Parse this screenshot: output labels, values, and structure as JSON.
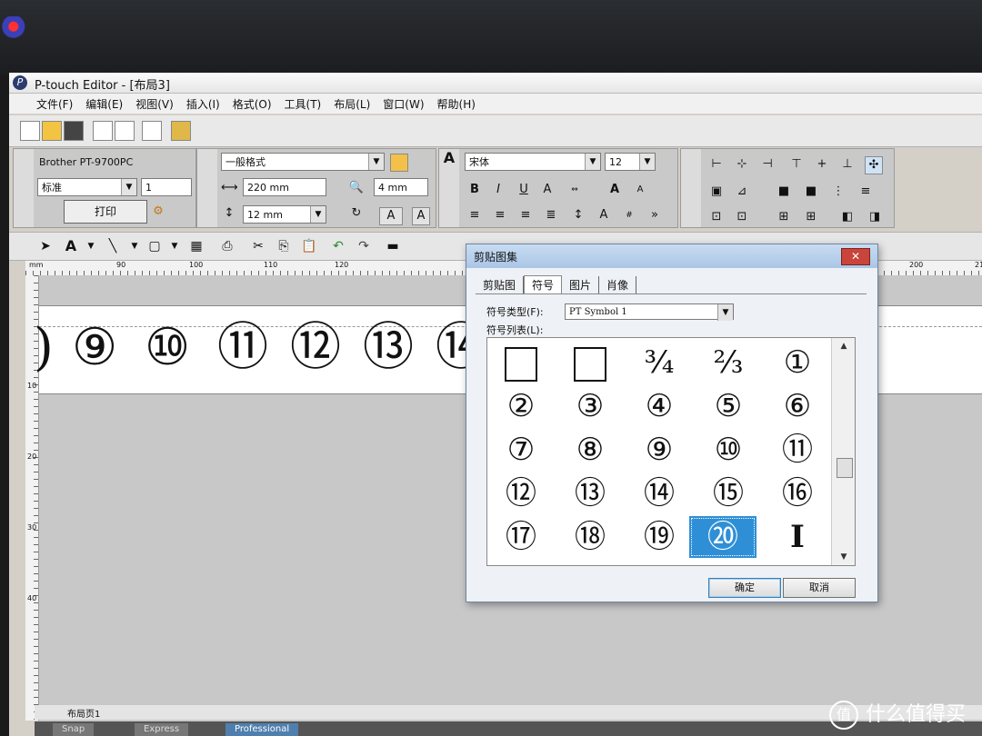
{
  "window": {
    "title": "P-touch Editor - [布局3]"
  },
  "menu": [
    "文件(F)",
    "编辑(E)",
    "视图(V)",
    "插入(I)",
    "格式(O)",
    "工具(T)",
    "布局(L)",
    "窗口(W)",
    "帮助(H)"
  ],
  "printer_panel": {
    "printer": "Brother PT-9700PC",
    "mode": "标准",
    "copies": "1",
    "print_label": "打印"
  },
  "page_panel": {
    "format": "一般格式",
    "length": "220 mm",
    "margin": "4 mm",
    "tape_width": "12 mm"
  },
  "text_panel": {
    "font": "宋体",
    "size": "12"
  },
  "ruler": {
    "h_marks": [
      "mm",
      "90",
      "100",
      "110",
      "120",
      "200",
      "21"
    ],
    "v_marks": [
      "10",
      "20",
      "30",
      "40"
    ]
  },
  "canvas": {
    "tape_symbols": [
      "⑨",
      "⑩",
      "⑪",
      "⑫",
      "⑬",
      "⑭"
    ],
    "partial_left": ")"
  },
  "dialog": {
    "title": "剪贴图集",
    "close": "✕",
    "tabs": [
      "剪贴图",
      "符号",
      "图片",
      "肖像"
    ],
    "active_tab": "符号",
    "type_label": "符号类型(F):",
    "type_value": "PT Symbol 1",
    "list_label": "符号列表(L):",
    "symbols": [
      "□",
      "□",
      "¾",
      "⅔",
      "①",
      "②",
      "③",
      "④",
      "⑤",
      "⑥",
      "⑦",
      "⑧",
      "⑨",
      "⑩",
      "⑪",
      "⑫",
      "⑬",
      "⑭",
      "⑮",
      "⑯",
      "⑰",
      "⑱",
      "⑲",
      "⑳",
      "I"
    ],
    "selected": "⑳",
    "ok": "确定",
    "cancel": "取消"
  },
  "statusbar": {
    "page": "布局页1"
  },
  "bottom_tabs": [
    "Snap",
    "Express",
    "Professional"
  ],
  "watermark": {
    "text": "什么值得买",
    "logo": "值"
  }
}
